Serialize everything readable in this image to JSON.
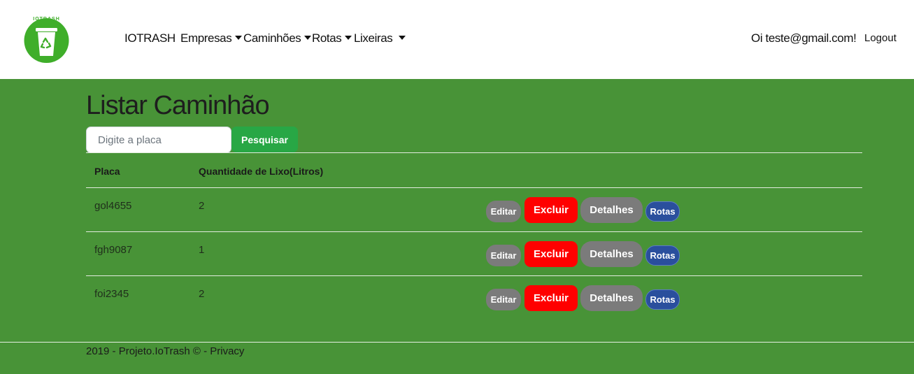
{
  "header": {
    "brand": "IOTRASH",
    "logo_text": "IOTRASH",
    "nav": [
      {
        "label": "Empresas"
      },
      {
        "label": "Caminhões"
      },
      {
        "label": "Rotas"
      },
      {
        "label": "Lixeiras"
      }
    ],
    "user_greeting": "Oi teste@gmail.com!",
    "logout": "Logout"
  },
  "main": {
    "title": "Listar Caminhão",
    "search": {
      "placeholder": "Digite a placa",
      "value": "",
      "button": "Pesquisar"
    },
    "table": {
      "headers": [
        "Placa",
        "Quantidade de Lixo(Litros)"
      ],
      "rows": [
        {
          "placa": "gol4655",
          "quantidade": "2"
        },
        {
          "placa": "fgh9087",
          "quantidade": "1"
        },
        {
          "placa": "foi2345",
          "quantidade": "2"
        }
      ],
      "actions": {
        "editar": "Editar",
        "excluir": "Excluir",
        "detalhes": "Detalhes",
        "rotas": "Rotas"
      }
    }
  },
  "footer": {
    "text": "2019 - Projeto.IoTrash © - ",
    "privacy": "Privacy"
  },
  "colors": {
    "page_bg": "#489337",
    "search_button": "#28a745",
    "delete_button": "#ff0000",
    "rotas_button": "#2a4f9d",
    "neutral_button": "#7b7b7b"
  }
}
